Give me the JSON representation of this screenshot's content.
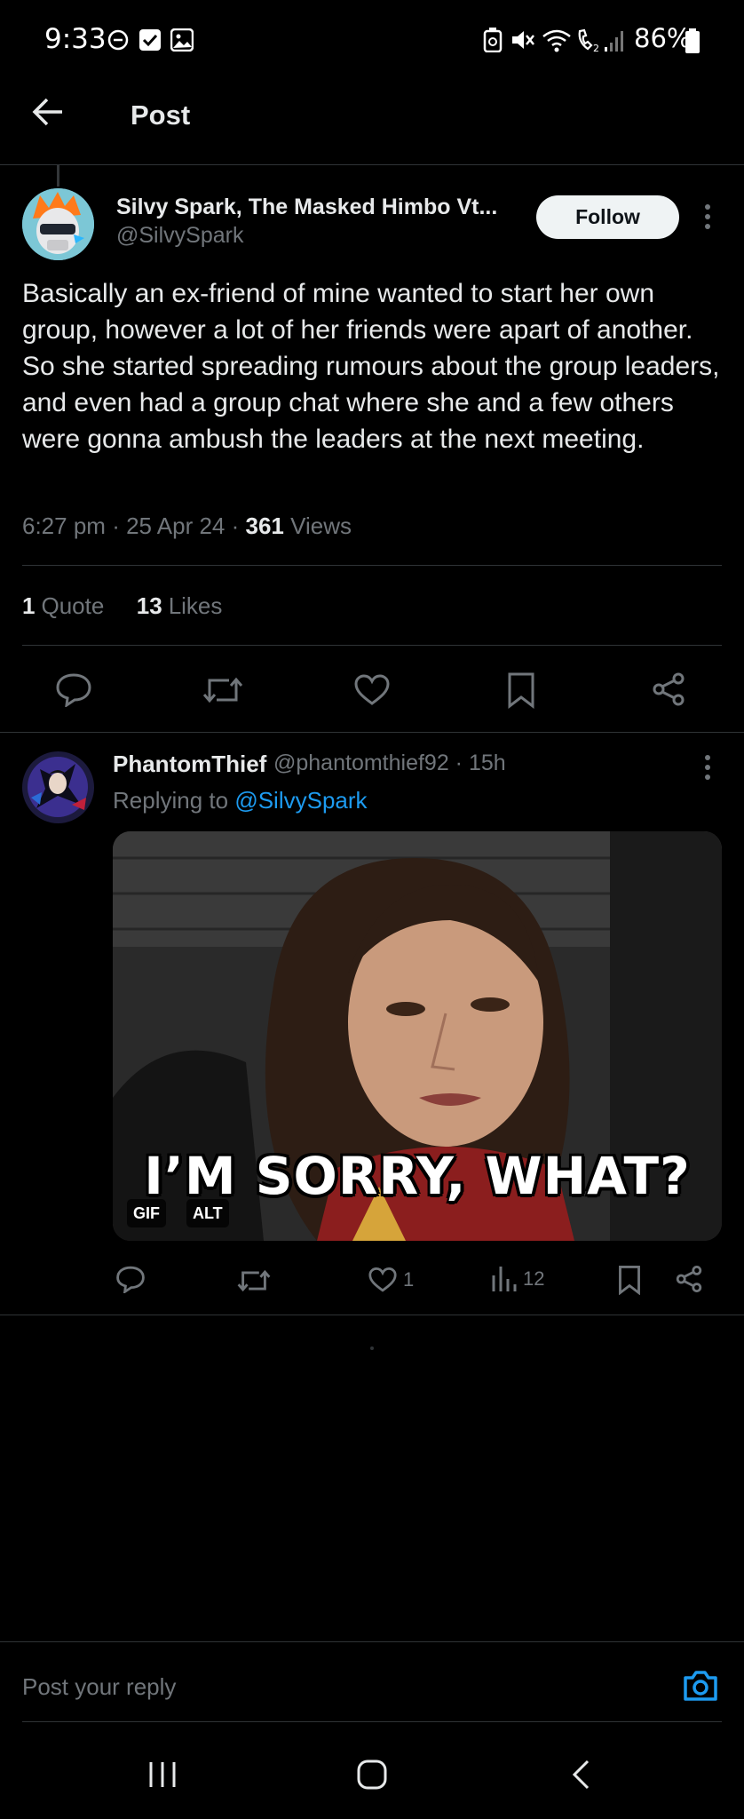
{
  "status_bar": {
    "time": "9:33",
    "battery": "86%"
  },
  "header": {
    "title": "Post"
  },
  "post": {
    "author_name": "Silvy Spark, The Masked Himbo Vt...",
    "author_handle": "@SilvySpark",
    "follow_label": "Follow",
    "text": "Basically an ex-friend of mine wanted to start her own group, however a lot of her friends were apart of another. So she started spreading rumours about the group leaders, and even had a group chat where she and a few others were gonna ambush the leaders at the next meeting.",
    "time": "6:27 pm",
    "date": "25 Apr 24",
    "views_count": "361",
    "views_label": "Views",
    "quotes_count": "1",
    "quotes_label": "Quote",
    "likes_count": "13",
    "likes_label": "Likes"
  },
  "reply": {
    "author_name": "PhantomThief",
    "author_handle_time": "@phantomthief92 · 15h",
    "replying_prefix": "Replying to",
    "replying_to": "@SilvySpark",
    "media_caption": "I’M SORRY, WHAT?",
    "badge_gif": "GIF",
    "badge_alt": "ALT",
    "likes": "1",
    "views": "12"
  },
  "composer": {
    "placeholder": "Post your reply"
  },
  "colors": {
    "accent": "#1d9bf0",
    "background": "#000000",
    "muted": "#71767b",
    "divider": "#2f3336"
  },
  "icons": [
    "back-arrow-icon",
    "more-icon",
    "reply-icon",
    "repost-icon",
    "like-icon",
    "bookmark-icon",
    "share-icon",
    "views-icon",
    "camera-icon",
    "recents-icon",
    "home-icon",
    "back-nav-icon"
  ]
}
